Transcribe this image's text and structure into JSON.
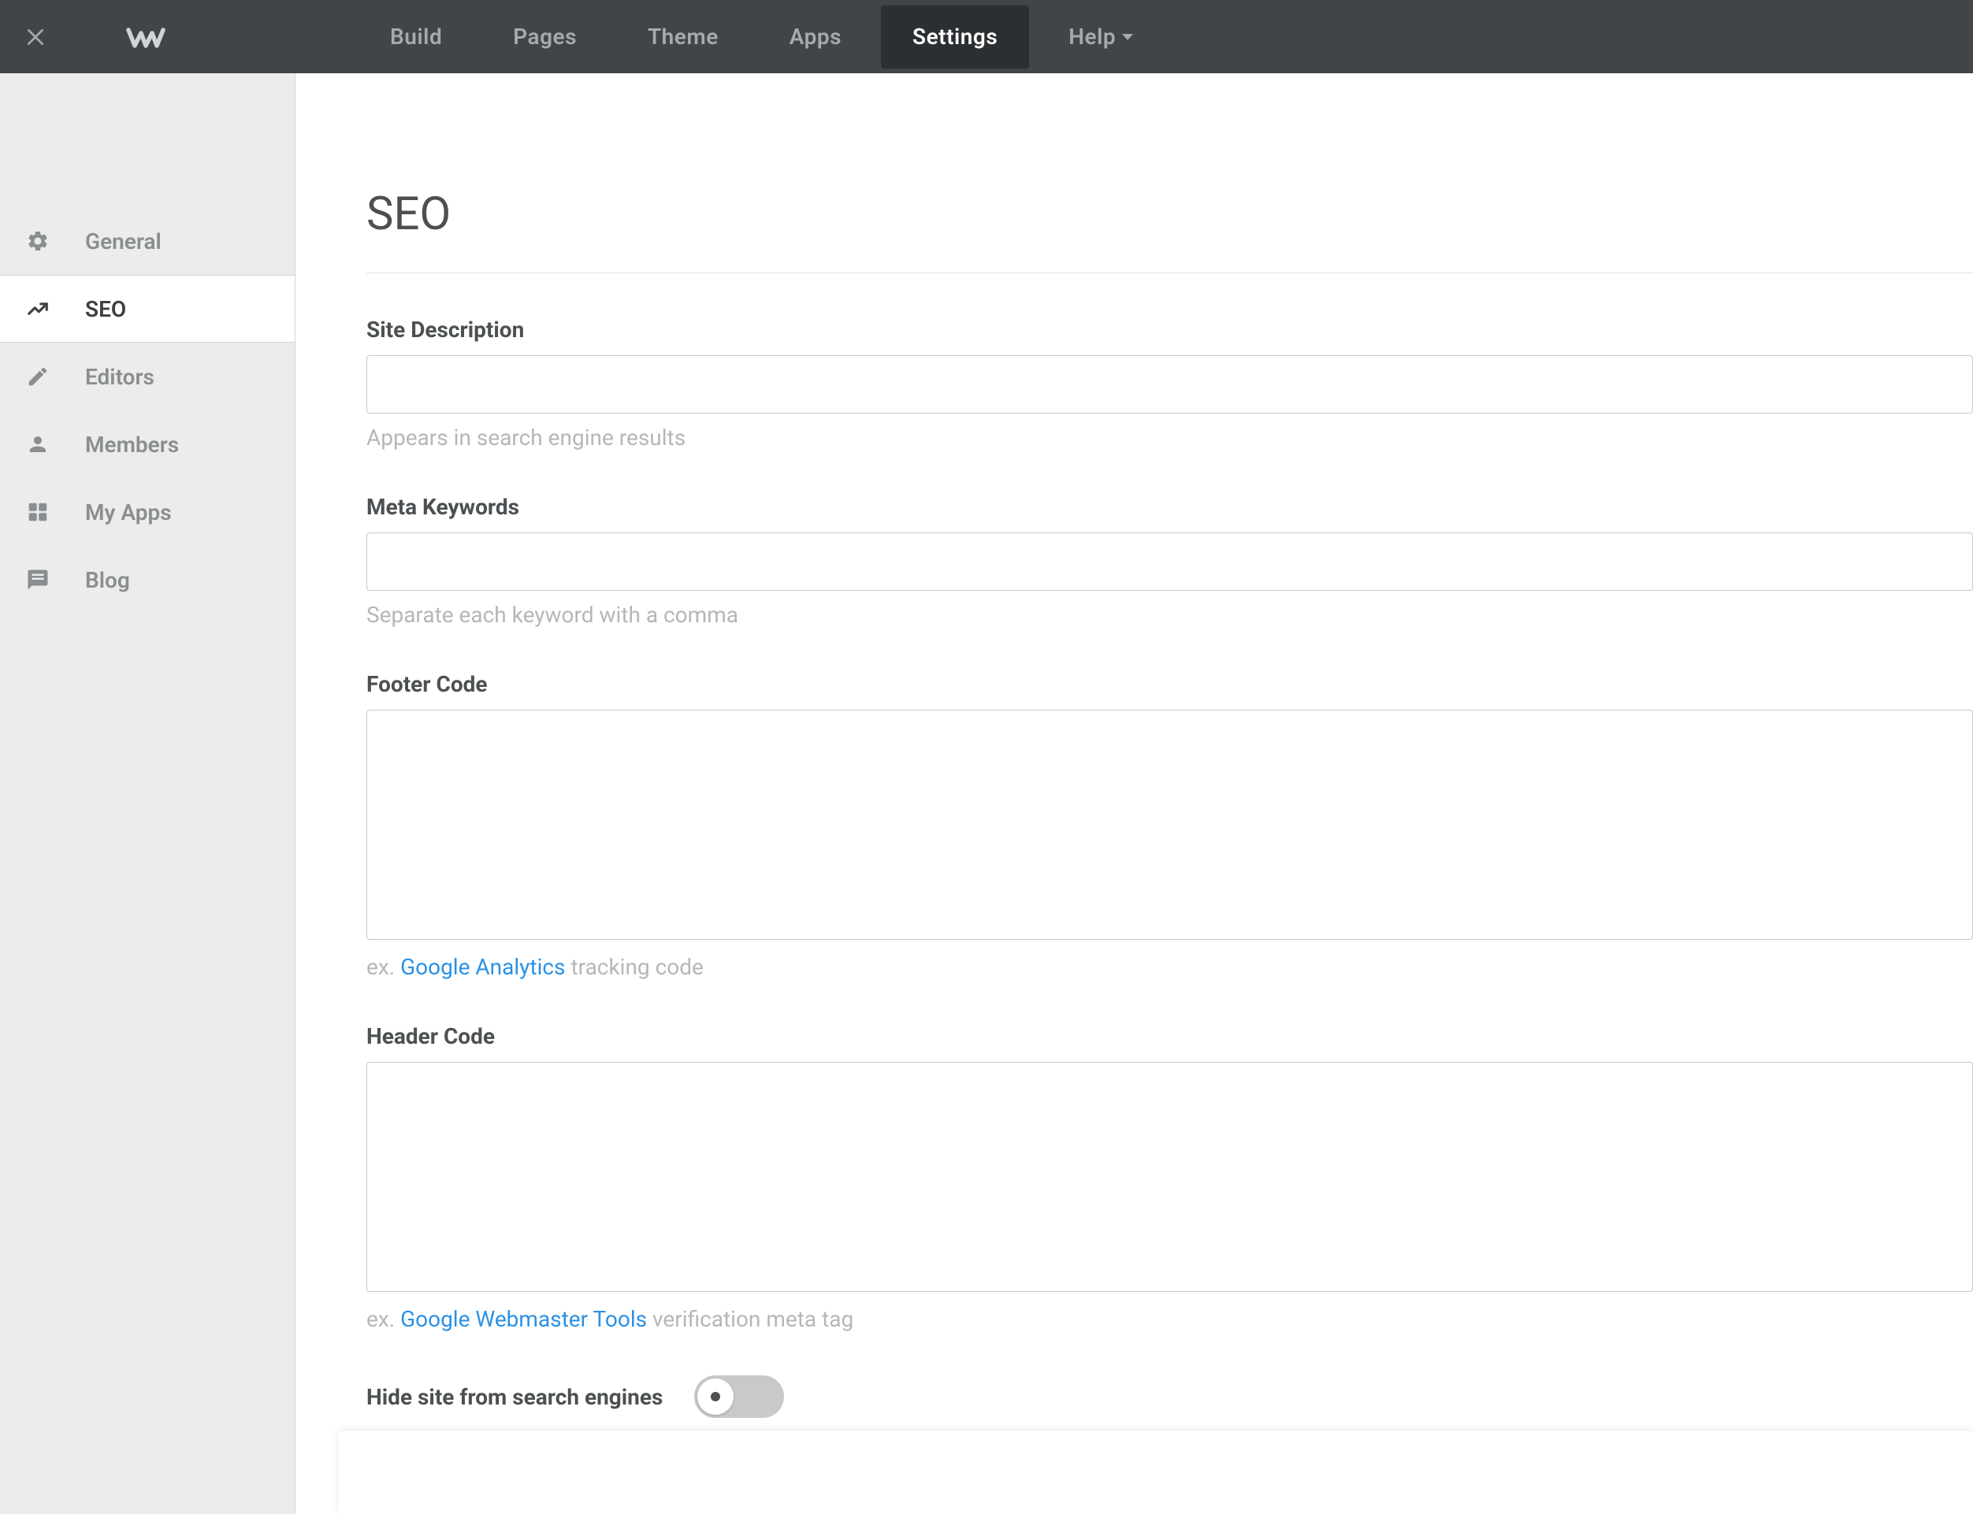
{
  "topnav": {
    "items": [
      {
        "label": "Build"
      },
      {
        "label": "Pages"
      },
      {
        "label": "Theme"
      },
      {
        "label": "Apps"
      },
      {
        "label": "Settings"
      },
      {
        "label": "Help"
      }
    ]
  },
  "sidebar": {
    "items": [
      {
        "label": "General"
      },
      {
        "label": "SEO"
      },
      {
        "label": "Editors"
      },
      {
        "label": "Members"
      },
      {
        "label": "My Apps"
      },
      {
        "label": "Blog"
      }
    ]
  },
  "page": {
    "title": "SEO",
    "fields": {
      "site_description": {
        "label": "Site Description",
        "value": "",
        "help": "Appears in search engine results"
      },
      "meta_keywords": {
        "label": "Meta Keywords",
        "value": "",
        "help": "Separate each keyword with a comma"
      },
      "footer_code": {
        "label": "Footer Code",
        "value": "",
        "help_prefix": "ex. ",
        "help_link": "Google Analytics",
        "help_suffix": " tracking code"
      },
      "header_code": {
        "label": "Header Code",
        "value": "",
        "help_prefix": "ex. ",
        "help_link": "Google Webmaster Tools",
        "help_suffix": " verification meta tag"
      },
      "hide_site": {
        "label": "Hide site from search engines"
      }
    }
  }
}
